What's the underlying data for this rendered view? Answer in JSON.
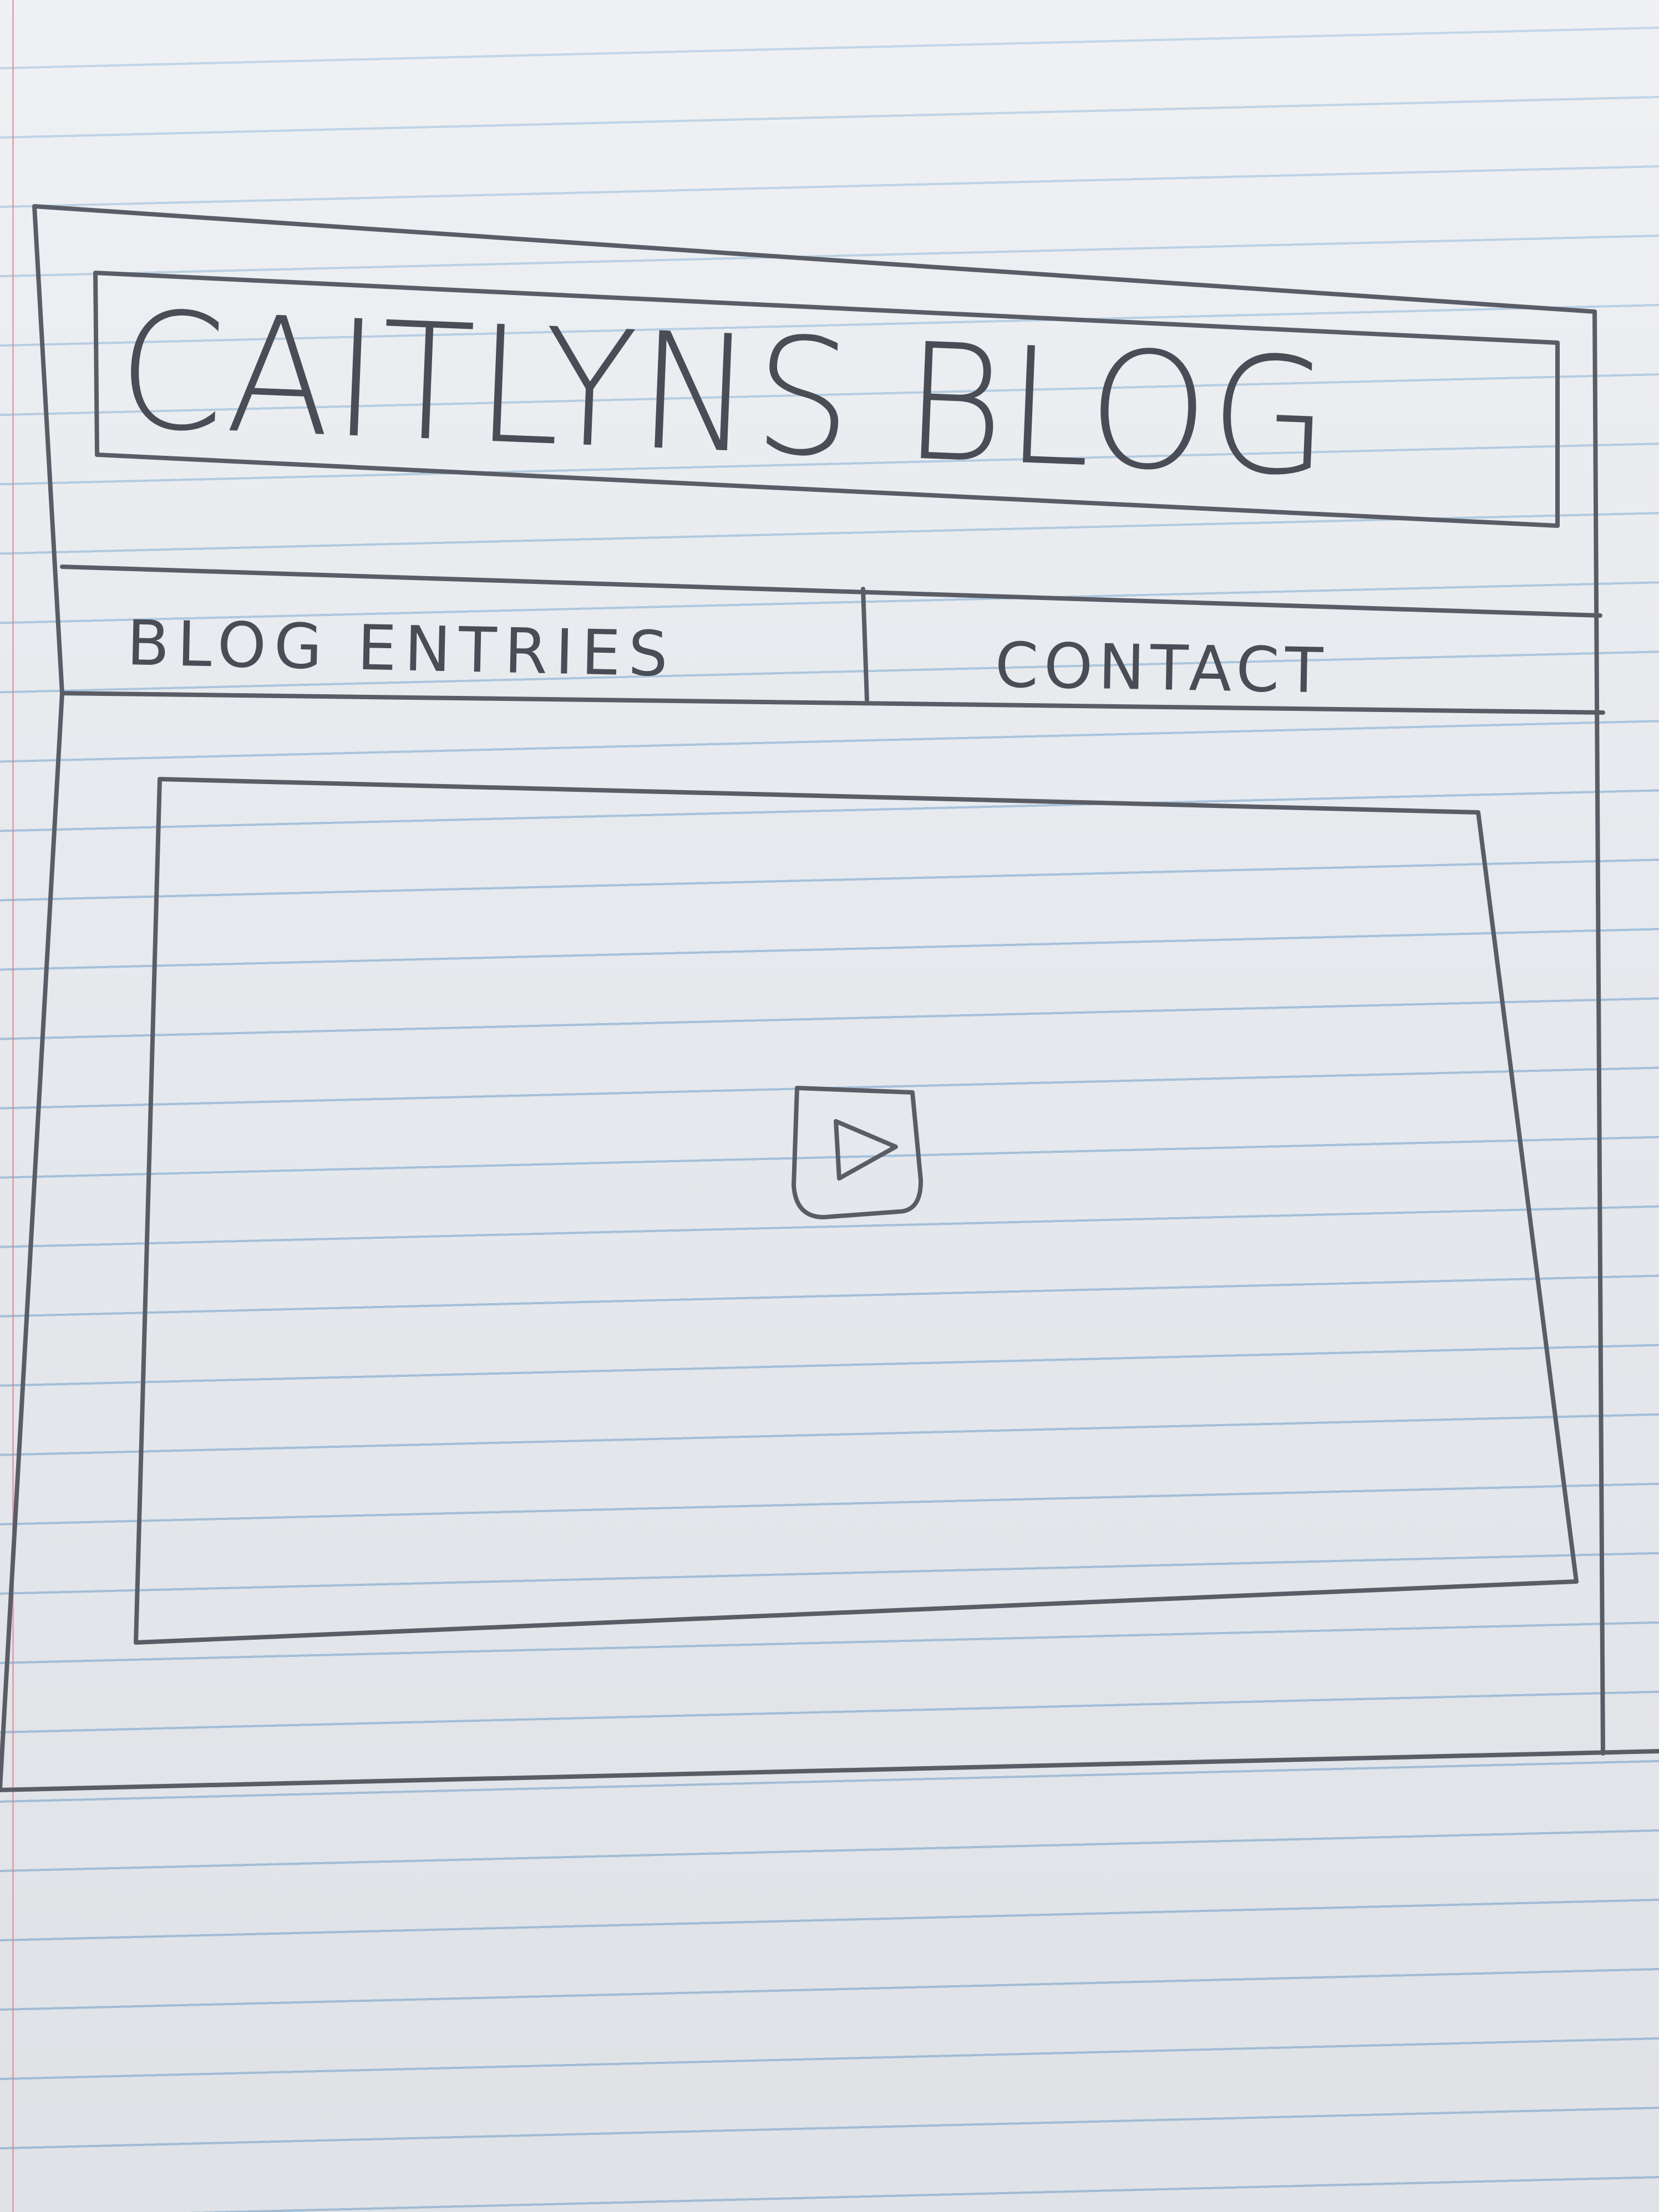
{
  "header": {
    "title": "CAITLYNS BLOG"
  },
  "nav": {
    "items": [
      {
        "label": "BLOG ENTRIES"
      },
      {
        "label": "CONTACT"
      }
    ]
  },
  "main": {
    "video": {
      "play_icon": "play-icon"
    }
  },
  "colors": {
    "paper": "#e6e9ed",
    "ruled_line": "#6ea0cd",
    "margin_line": "#e1788c",
    "pencil": "#5a5d66"
  }
}
